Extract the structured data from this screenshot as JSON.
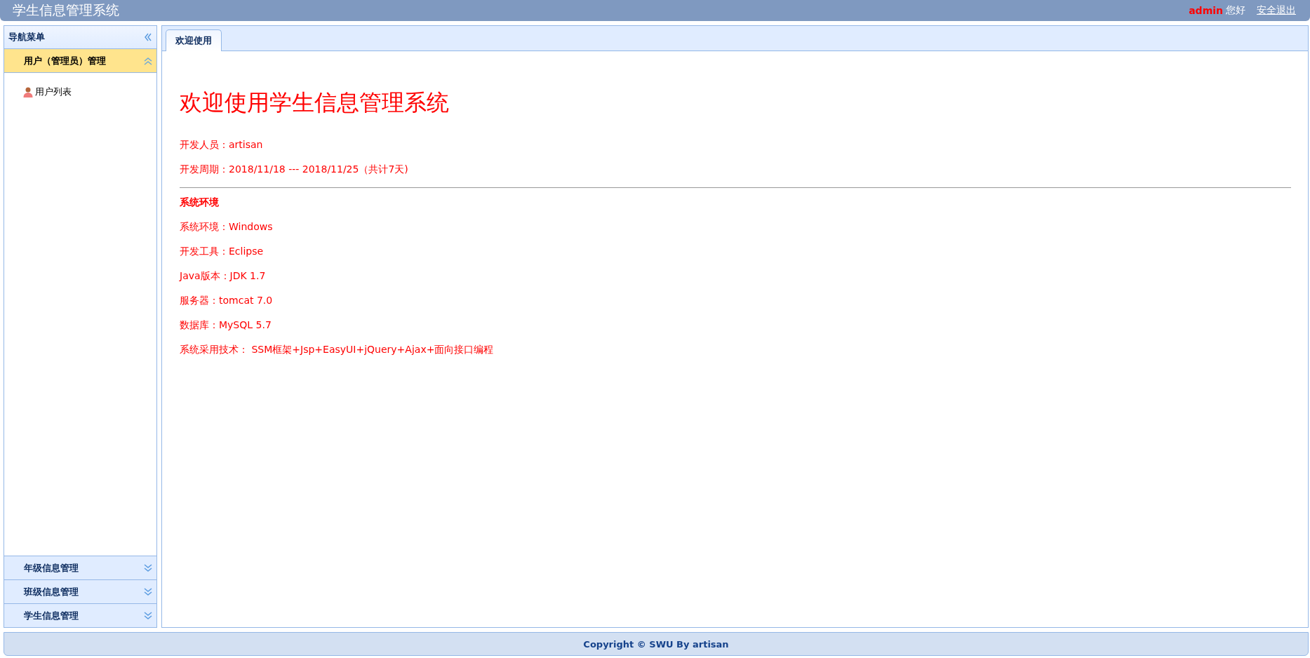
{
  "header": {
    "title": "学生信息管理系统",
    "user": "admin",
    "greeting": "您好",
    "logout": "安全退出"
  },
  "sidebar": {
    "title": "导航菜单",
    "panels": [
      {
        "title": "用户（管理员）管理",
        "expanded": true,
        "items": [
          {
            "label": "用户列表"
          }
        ]
      },
      {
        "title": "年级信息管理",
        "expanded": false
      },
      {
        "title": "班级信息管理",
        "expanded": false
      },
      {
        "title": "学生信息管理",
        "expanded": false
      }
    ]
  },
  "tabs": [
    {
      "label": "欢迎使用",
      "selected": true
    }
  ],
  "content": {
    "heading": "欢迎使用学生信息管理系统",
    "lines": [
      {
        "kind": "text",
        "text": "开发人员：artisan"
      },
      {
        "kind": "text",
        "text": "开发周期：2018/11/18 --- 2018/11/25（共计7天)"
      },
      {
        "kind": "divider"
      },
      {
        "kind": "heading",
        "text": "系统环境"
      },
      {
        "kind": "text",
        "text": "系统环境：Windows"
      },
      {
        "kind": "text",
        "text": "开发工具：Eclipse"
      },
      {
        "kind": "text",
        "text": "Java版本：JDK 1.7"
      },
      {
        "kind": "text",
        "text": "服务器：tomcat 7.0"
      },
      {
        "kind": "text",
        "text": "数据库：MySQL 5.7"
      },
      {
        "kind": "text",
        "text": "系统采用技术：  SSM框架+Jsp+EasyUI+jQuery+Ajax+面向接口编程"
      }
    ]
  },
  "footer": {
    "text": "Copyright © SWU By artisan"
  }
}
